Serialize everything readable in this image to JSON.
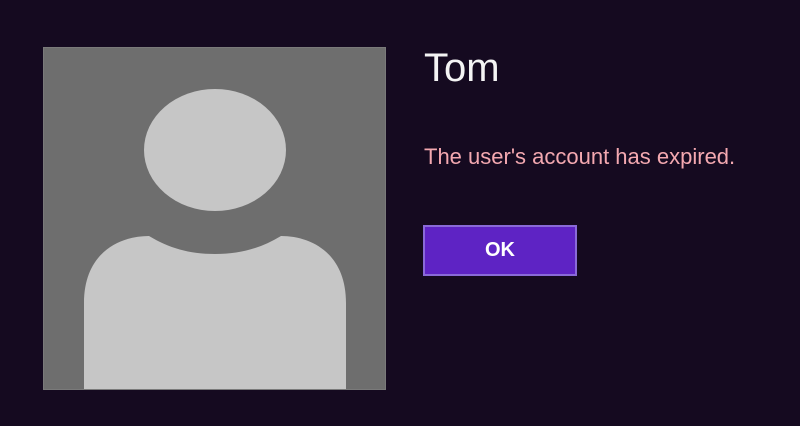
{
  "user": {
    "name": "Tom"
  },
  "dialog": {
    "message": "The user's account has expired.",
    "ok_label": "OK"
  },
  "avatar": {
    "icon": "default-user-silhouette-icon"
  },
  "colors": {
    "background": "#150a20",
    "avatar_tile": "#6e6e6e",
    "silhouette": "#c6c6c6",
    "message_text": "#f3a8b0",
    "button_fill": "#5e23c4",
    "button_border": "#8a6ad8"
  }
}
